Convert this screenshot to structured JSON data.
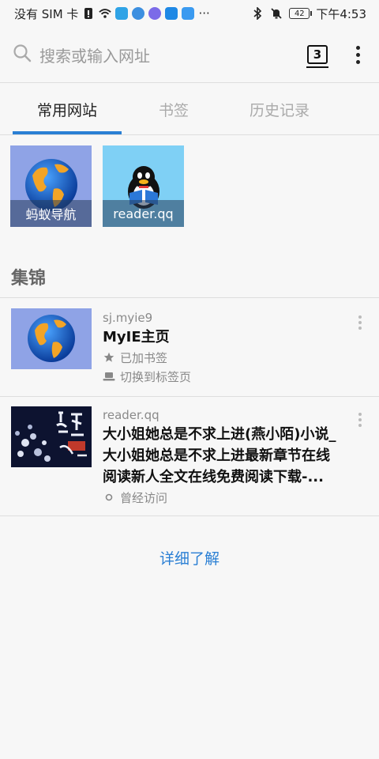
{
  "status_bar": {
    "carrier": "没有 SIM 卡",
    "battery": "42",
    "time": "下午4:53",
    "overflow": "···"
  },
  "search": {
    "placeholder": "搜索或输入网址",
    "tab_count": "3"
  },
  "tabs": [
    {
      "label": "常用网站",
      "active": true
    },
    {
      "label": "书签",
      "active": false
    },
    {
      "label": "历史记录",
      "active": false
    }
  ],
  "shortcuts": [
    {
      "label": "蚂蚁导航",
      "icon": "globe-icon"
    },
    {
      "label": "reader.qq",
      "icon": "qq-penguin-icon"
    }
  ],
  "collection": {
    "heading": "集锦",
    "items": [
      {
        "source": "sj.myie9",
        "title": "MyIE主页",
        "meta": [
          {
            "icon": "star-icon",
            "text": "已加书签"
          },
          {
            "icon": "laptop-icon",
            "text": "切换到标签页"
          }
        ]
      },
      {
        "source": "reader.qq",
        "title_lines": [
          "大小姐她总是不求上进(燕小陌)小说_",
          "大小姐她总是不求上进最新章节在线",
          "阅读新人全文在线免费阅读下载-..."
        ],
        "meta": [
          {
            "icon": "circle-icon",
            "text": "曾经访问"
          }
        ]
      }
    ]
  },
  "learn_more": "详细了解",
  "colors": {
    "accent": "#2a7fd4",
    "background": "#f7f7f7"
  }
}
